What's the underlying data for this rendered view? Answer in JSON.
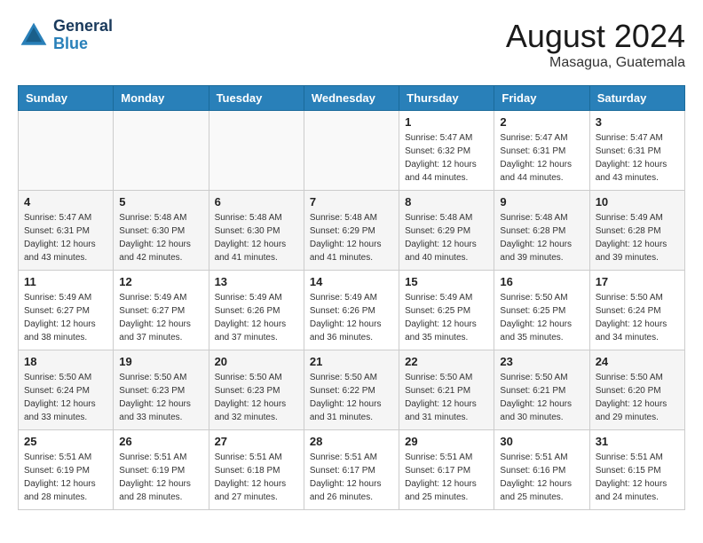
{
  "header": {
    "logo_line1": "General",
    "logo_line2": "Blue",
    "title": "August 2024",
    "subtitle": "Masagua, Guatemala"
  },
  "days_of_week": [
    "Sunday",
    "Monday",
    "Tuesday",
    "Wednesday",
    "Thursday",
    "Friday",
    "Saturday"
  ],
  "weeks": [
    [
      {
        "day": "",
        "info": ""
      },
      {
        "day": "",
        "info": ""
      },
      {
        "day": "",
        "info": ""
      },
      {
        "day": "",
        "info": ""
      },
      {
        "day": "1",
        "info": "Sunrise: 5:47 AM\nSunset: 6:32 PM\nDaylight: 12 hours\nand 44 minutes."
      },
      {
        "day": "2",
        "info": "Sunrise: 5:47 AM\nSunset: 6:31 PM\nDaylight: 12 hours\nand 44 minutes."
      },
      {
        "day": "3",
        "info": "Sunrise: 5:47 AM\nSunset: 6:31 PM\nDaylight: 12 hours\nand 43 minutes."
      }
    ],
    [
      {
        "day": "4",
        "info": "Sunrise: 5:47 AM\nSunset: 6:31 PM\nDaylight: 12 hours\nand 43 minutes."
      },
      {
        "day": "5",
        "info": "Sunrise: 5:48 AM\nSunset: 6:30 PM\nDaylight: 12 hours\nand 42 minutes."
      },
      {
        "day": "6",
        "info": "Sunrise: 5:48 AM\nSunset: 6:30 PM\nDaylight: 12 hours\nand 41 minutes."
      },
      {
        "day": "7",
        "info": "Sunrise: 5:48 AM\nSunset: 6:29 PM\nDaylight: 12 hours\nand 41 minutes."
      },
      {
        "day": "8",
        "info": "Sunrise: 5:48 AM\nSunset: 6:29 PM\nDaylight: 12 hours\nand 40 minutes."
      },
      {
        "day": "9",
        "info": "Sunrise: 5:48 AM\nSunset: 6:28 PM\nDaylight: 12 hours\nand 39 minutes."
      },
      {
        "day": "10",
        "info": "Sunrise: 5:49 AM\nSunset: 6:28 PM\nDaylight: 12 hours\nand 39 minutes."
      }
    ],
    [
      {
        "day": "11",
        "info": "Sunrise: 5:49 AM\nSunset: 6:27 PM\nDaylight: 12 hours\nand 38 minutes."
      },
      {
        "day": "12",
        "info": "Sunrise: 5:49 AM\nSunset: 6:27 PM\nDaylight: 12 hours\nand 37 minutes."
      },
      {
        "day": "13",
        "info": "Sunrise: 5:49 AM\nSunset: 6:26 PM\nDaylight: 12 hours\nand 37 minutes."
      },
      {
        "day": "14",
        "info": "Sunrise: 5:49 AM\nSunset: 6:26 PM\nDaylight: 12 hours\nand 36 minutes."
      },
      {
        "day": "15",
        "info": "Sunrise: 5:49 AM\nSunset: 6:25 PM\nDaylight: 12 hours\nand 35 minutes."
      },
      {
        "day": "16",
        "info": "Sunrise: 5:50 AM\nSunset: 6:25 PM\nDaylight: 12 hours\nand 35 minutes."
      },
      {
        "day": "17",
        "info": "Sunrise: 5:50 AM\nSunset: 6:24 PM\nDaylight: 12 hours\nand 34 minutes."
      }
    ],
    [
      {
        "day": "18",
        "info": "Sunrise: 5:50 AM\nSunset: 6:24 PM\nDaylight: 12 hours\nand 33 minutes."
      },
      {
        "day": "19",
        "info": "Sunrise: 5:50 AM\nSunset: 6:23 PM\nDaylight: 12 hours\nand 33 minutes."
      },
      {
        "day": "20",
        "info": "Sunrise: 5:50 AM\nSunset: 6:23 PM\nDaylight: 12 hours\nand 32 minutes."
      },
      {
        "day": "21",
        "info": "Sunrise: 5:50 AM\nSunset: 6:22 PM\nDaylight: 12 hours\nand 31 minutes."
      },
      {
        "day": "22",
        "info": "Sunrise: 5:50 AM\nSunset: 6:21 PM\nDaylight: 12 hours\nand 31 minutes."
      },
      {
        "day": "23",
        "info": "Sunrise: 5:50 AM\nSunset: 6:21 PM\nDaylight: 12 hours\nand 30 minutes."
      },
      {
        "day": "24",
        "info": "Sunrise: 5:50 AM\nSunset: 6:20 PM\nDaylight: 12 hours\nand 29 minutes."
      }
    ],
    [
      {
        "day": "25",
        "info": "Sunrise: 5:51 AM\nSunset: 6:19 PM\nDaylight: 12 hours\nand 28 minutes."
      },
      {
        "day": "26",
        "info": "Sunrise: 5:51 AM\nSunset: 6:19 PM\nDaylight: 12 hours\nand 28 minutes."
      },
      {
        "day": "27",
        "info": "Sunrise: 5:51 AM\nSunset: 6:18 PM\nDaylight: 12 hours\nand 27 minutes."
      },
      {
        "day": "28",
        "info": "Sunrise: 5:51 AM\nSunset: 6:17 PM\nDaylight: 12 hours\nand 26 minutes."
      },
      {
        "day": "29",
        "info": "Sunrise: 5:51 AM\nSunset: 6:17 PM\nDaylight: 12 hours\nand 25 minutes."
      },
      {
        "day": "30",
        "info": "Sunrise: 5:51 AM\nSunset: 6:16 PM\nDaylight: 12 hours\nand 25 minutes."
      },
      {
        "day": "31",
        "info": "Sunrise: 5:51 AM\nSunset: 6:15 PM\nDaylight: 12 hours\nand 24 minutes."
      }
    ]
  ]
}
